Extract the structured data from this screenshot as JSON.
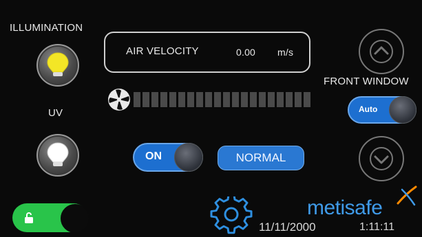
{
  "illumination": {
    "label": "ILLUMINATION",
    "icon": "lightbulb-on-icon",
    "color": "#f3e626"
  },
  "uv": {
    "label": "UV",
    "icon": "lightbulb-off-icon",
    "color": "#ffffff"
  },
  "air_velocity": {
    "label": "AIR VELOCITY",
    "value": "0.00",
    "unit": "m/s"
  },
  "fan": {
    "icon": "fan-icon",
    "level": 0
  },
  "front_window": {
    "label": "FRONT WINDOW",
    "mode": "Auto"
  },
  "fan_toggle": {
    "state": "ON"
  },
  "status": {
    "text": "NORMAL"
  },
  "lock": {
    "icon": "unlock-icon",
    "color": "#29c44a"
  },
  "brand": {
    "text": "metisafe",
    "accent": "#ff8a00",
    "brand_color": "#3f9ae8"
  },
  "settings": {
    "icon": "gear-icon",
    "color": "#2e8fe0"
  },
  "datetime": {
    "date": "11/11/2000",
    "time": "1:11:11"
  }
}
